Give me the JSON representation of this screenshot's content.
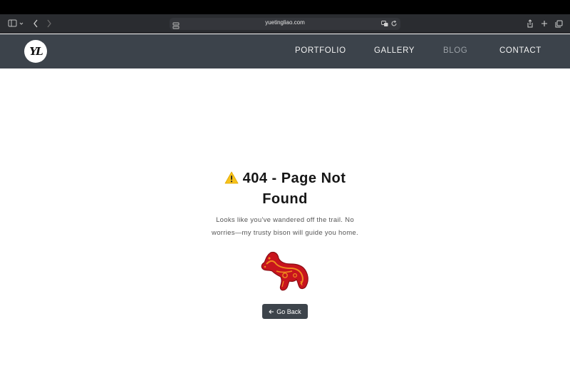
{
  "browser": {
    "url": "yuetingliao.com"
  },
  "site": {
    "logo_text": "YL",
    "nav": [
      {
        "label": "PORTFOLIO"
      },
      {
        "label": "GALLERY"
      },
      {
        "label": "BLOG"
      },
      {
        "label": "CONTACT"
      }
    ]
  },
  "error": {
    "title": "404 - Page Not Found",
    "message": "Looks like you've wandered off the trail. No worries—my trusty bison will guide you home.",
    "button_label": "Go Back",
    "button_icon": "arrow-left-icon",
    "warning_icon": "warning-icon",
    "illustration": "bison-illustration"
  },
  "colors": {
    "header_bg": "#3c434b",
    "button_bg": "#3d444b",
    "bison_red": "#c8141e",
    "bison_orange": "#f08a1e"
  }
}
